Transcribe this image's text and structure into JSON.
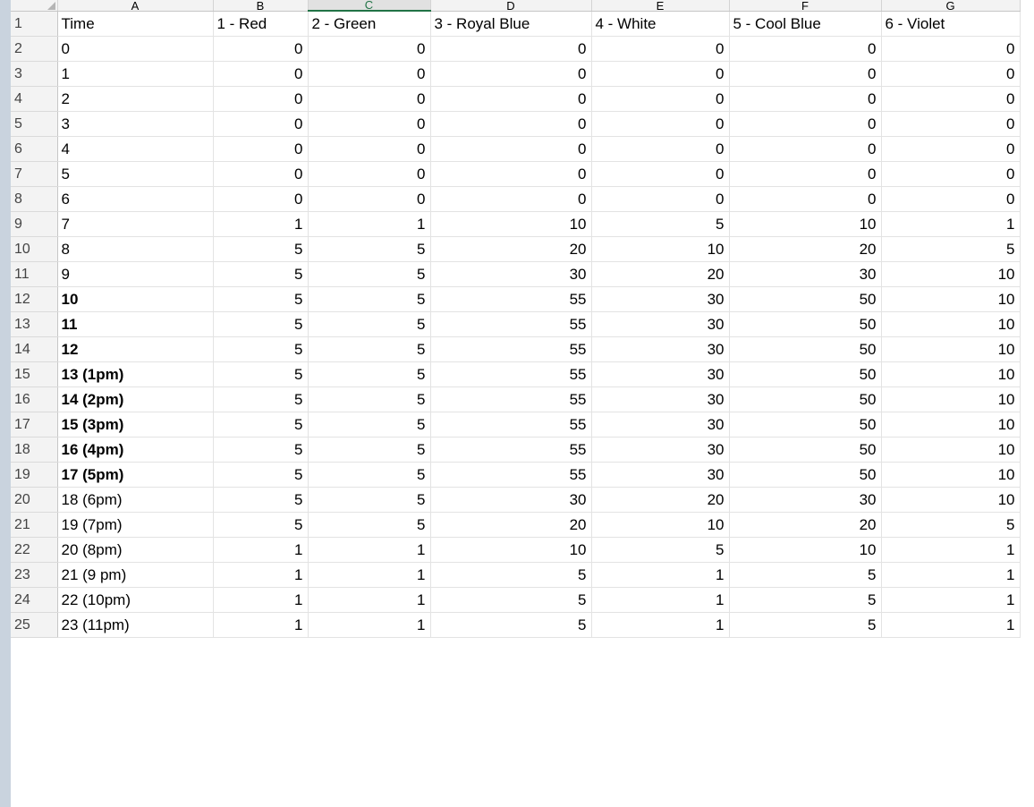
{
  "spreadsheet": {
    "column_headers": [
      "A",
      "B",
      "C",
      "D",
      "E",
      "F",
      "G"
    ],
    "selected_column": "C",
    "rows": [
      {
        "num": "1",
        "cells": [
          "Time",
          "1 - Red",
          "2 - Green",
          "3 - Royal Blue",
          "4 - White",
          "5 - Cool Blue",
          "6 - Violet"
        ],
        "header": true
      },
      {
        "num": "2",
        "cells": [
          "0",
          "0",
          "0",
          "0",
          "0",
          "0",
          "0"
        ],
        "bold": false
      },
      {
        "num": "3",
        "cells": [
          "1",
          "0",
          "0",
          "0",
          "0",
          "0",
          "0"
        ],
        "bold": false
      },
      {
        "num": "4",
        "cells": [
          "2",
          "0",
          "0",
          "0",
          "0",
          "0",
          "0"
        ],
        "bold": false
      },
      {
        "num": "5",
        "cells": [
          "3",
          "0",
          "0",
          "0",
          "0",
          "0",
          "0"
        ],
        "bold": false
      },
      {
        "num": "6",
        "cells": [
          "4",
          "0",
          "0",
          "0",
          "0",
          "0",
          "0"
        ],
        "bold": false
      },
      {
        "num": "7",
        "cells": [
          "5",
          "0",
          "0",
          "0",
          "0",
          "0",
          "0"
        ],
        "bold": false
      },
      {
        "num": "8",
        "cells": [
          "6",
          "0",
          "0",
          "0",
          "0",
          "0",
          "0"
        ],
        "bold": false
      },
      {
        "num": "9",
        "cells": [
          "7",
          "1",
          "1",
          "10",
          "5",
          "10",
          "1"
        ],
        "bold": false
      },
      {
        "num": "10",
        "cells": [
          "8",
          "5",
          "5",
          "20",
          "10",
          "20",
          "5"
        ],
        "bold": false
      },
      {
        "num": "11",
        "cells": [
          "9",
          "5",
          "5",
          "30",
          "20",
          "30",
          "10"
        ],
        "bold": false
      },
      {
        "num": "12",
        "cells": [
          "10",
          "5",
          "5",
          "55",
          "30",
          "50",
          "10"
        ],
        "bold": true
      },
      {
        "num": "13",
        "cells": [
          "11",
          "5",
          "5",
          "55",
          "30",
          "50",
          "10"
        ],
        "bold": true
      },
      {
        "num": "14",
        "cells": [
          "12",
          "5",
          "5",
          "55",
          "30",
          "50",
          "10"
        ],
        "bold": true
      },
      {
        "num": "15",
        "cells": [
          "13 (1pm)",
          "5",
          "5",
          "55",
          "30",
          "50",
          "10"
        ],
        "bold": true
      },
      {
        "num": "16",
        "cells": [
          "14 (2pm)",
          "5",
          "5",
          "55",
          "30",
          "50",
          "10"
        ],
        "bold": true
      },
      {
        "num": "17",
        "cells": [
          "15 (3pm)",
          "5",
          "5",
          "55",
          "30",
          "50",
          "10"
        ],
        "bold": true
      },
      {
        "num": "18",
        "cells": [
          "16 (4pm)",
          "5",
          "5",
          "55",
          "30",
          "50",
          "10"
        ],
        "bold": true
      },
      {
        "num": "19",
        "cells": [
          "17 (5pm)",
          "5",
          "5",
          "55",
          "30",
          "50",
          "10"
        ],
        "bold": true
      },
      {
        "num": "20",
        "cells": [
          "18 (6pm)",
          "5",
          "5",
          "30",
          "20",
          "30",
          "10"
        ],
        "bold": false
      },
      {
        "num": "21",
        "cells": [
          "19 (7pm)",
          "5",
          "5",
          "20",
          "10",
          "20",
          "5"
        ],
        "bold": false
      },
      {
        "num": "22",
        "cells": [
          "20 (8pm)",
          "1",
          "1",
          "10",
          "5",
          "10",
          "1"
        ],
        "bold": false
      },
      {
        "num": "23",
        "cells": [
          "21 (9 pm)",
          "1",
          "1",
          "5",
          "1",
          "5",
          "1"
        ],
        "bold": false
      },
      {
        "num": "24",
        "cells": [
          "22 (10pm)",
          "1",
          "1",
          "5",
          "1",
          "5",
          "1"
        ],
        "bold": false
      },
      {
        "num": "25",
        "cells": [
          "23 (11pm)",
          "1",
          "1",
          "5",
          "1",
          "5",
          "1"
        ],
        "bold": false
      }
    ]
  },
  "colors": {
    "selected_column_accent": "#217346",
    "header_background": "#f3f3f3",
    "sidebar": "#c9d3de"
  }
}
